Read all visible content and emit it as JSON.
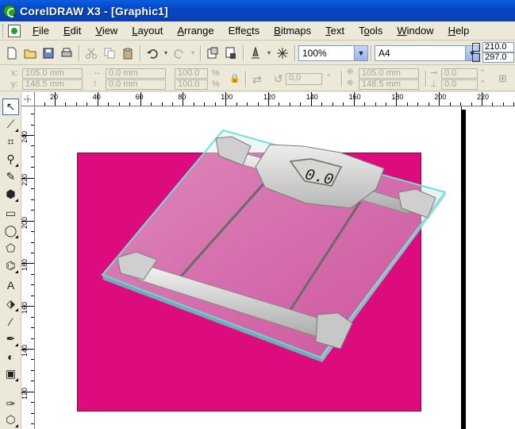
{
  "window": {
    "title": "CorelDRAW X3 - [Graphic1]"
  },
  "menu": [
    "File",
    "Edit",
    "View",
    "Layout",
    "Arrange",
    "Effects",
    "Bitmaps",
    "Text",
    "Tools",
    "Window",
    "Help"
  ],
  "menu_underline": [
    "F",
    "E",
    "V",
    "L",
    "A",
    "c",
    "B",
    "T",
    "o",
    "W",
    "H"
  ],
  "toolbar": {
    "zoom": "100%",
    "page_preset": "A4",
    "page_width": "210.0 mm",
    "page_height": "297.0 mm"
  },
  "property_bar": {
    "x_label": "x:",
    "y_label": "y:",
    "x": "105.0 mm",
    "y": "148.5 mm",
    "w": "0.0 mm",
    "h": "0.0 mm",
    "scale_x": "100.0",
    "scale_y": "100.0",
    "percent": "%",
    "rotation": "0,0",
    "degree": "°",
    "center_x": "105.0 mm",
    "center_y": "148.5 mm",
    "skew_x": "0.0",
    "skew_y": "0.0"
  },
  "ruler_top": [
    "20",
    "40",
    "60",
    "80",
    "100",
    "120",
    "140",
    "160",
    "180",
    "200",
    "220"
  ],
  "ruler_left": [
    "240",
    "220",
    "200",
    "180",
    "160",
    "140",
    "120"
  ],
  "scale_display": {
    "digits": "0.0"
  },
  "colors": {
    "title_bar": "#0447c2",
    "chrome": "#ece9d8",
    "magenta_rect": "#dc0b7e",
    "glass": "#6fe0d6"
  },
  "tools": [
    "pick-tool",
    "shape-tool",
    "crop-tool",
    "zoom-tool",
    "freehand-tool",
    "smart-fill-tool",
    "rectangle-tool",
    "ellipse-tool",
    "polygon-tool",
    "basic-shapes-tool",
    "text-tool",
    "interactive-blend-tool",
    "eyedropper-tool",
    "outline-tool",
    "fill-tool",
    "interactive-fill-tool",
    "pen-tool",
    "mesh-fill-tool"
  ]
}
